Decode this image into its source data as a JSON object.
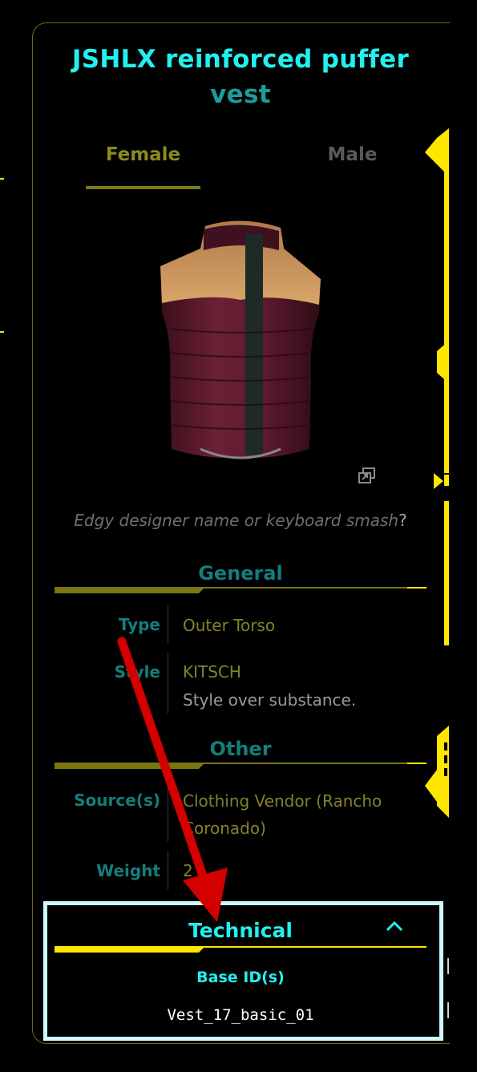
{
  "item": {
    "title_line1": "JSHLX reinforced puffer",
    "title_line2": "vest",
    "caption_text": "Edgy designer name or keyboard smash",
    "caption_q": "?"
  },
  "tabs": [
    {
      "label": "Female",
      "active": true
    },
    {
      "label": "Male",
      "active": false
    }
  ],
  "sections": {
    "general": {
      "heading": "General",
      "type_label": "Type",
      "type_value": "Outer Torso",
      "style_label": "Style",
      "style_value": "KITSCH",
      "style_desc": "Style over substance."
    },
    "other": {
      "heading": "Other",
      "source_label": "Source(s)",
      "source_value": "Clothing Vendor (Rancho Coronado)",
      "weight_label": "Weight",
      "weight_value": "2"
    },
    "technical": {
      "heading": "Technical",
      "base_id_label": "Base ID(s)",
      "base_id_value": "Vest_17_basic_01"
    }
  },
  "icons": {
    "expand": "expand-icon",
    "collapse": "chevron-up-icon"
  },
  "colors": {
    "accent_cyan": "#22f0ef",
    "accent_teal": "#147e7b",
    "accent_yellow": "#ffe600",
    "olive": "#84822a",
    "annotation_red": "#d40000"
  }
}
